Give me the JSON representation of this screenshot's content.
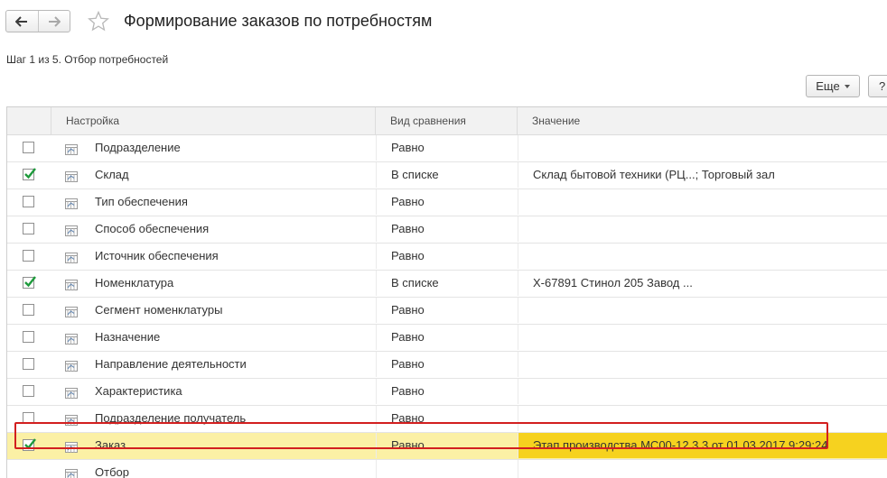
{
  "window": {
    "title": "Формирование заказов по потребностям",
    "step_text": "Шаг 1 из 5. Отбор потребностей"
  },
  "toolbar": {
    "back_icon": "arrow-left-icon",
    "forward_icon": "arrow-right-icon",
    "favorite_icon": "star-outline-icon",
    "more_label": "Еще",
    "help_label": "?"
  },
  "table": {
    "columns": [
      "Настройка",
      "Вид сравнения",
      "Значение"
    ],
    "rows": [
      {
        "checked": false,
        "name": "Подразделение",
        "comparison": "Равно",
        "value": ""
      },
      {
        "checked": true,
        "name": "Склад",
        "comparison": "В списке",
        "value": "Склад бытовой техники (РЦ...; Торговый зал"
      },
      {
        "checked": false,
        "name": "Тип обеспечения",
        "comparison": "Равно",
        "value": ""
      },
      {
        "checked": false,
        "name": "Способ обеспечения",
        "comparison": "Равно",
        "value": ""
      },
      {
        "checked": false,
        "name": "Источник обеспечения",
        "comparison": "Равно",
        "value": ""
      },
      {
        "checked": true,
        "name": "Номенклатура",
        "comparison": "В списке",
        "value": "Х-67891 Стинол 205 Завод ..."
      },
      {
        "checked": false,
        "name": "Сегмент номенклатуры",
        "comparison": "Равно",
        "value": ""
      },
      {
        "checked": false,
        "name": "Назначение",
        "comparison": "Равно",
        "value": ""
      },
      {
        "checked": false,
        "name": "Направление деятельности",
        "comparison": "Равно",
        "value": ""
      },
      {
        "checked": false,
        "name": "Характеристика",
        "comparison": "Равно",
        "value": ""
      },
      {
        "checked": false,
        "name": "Подразделение получатель",
        "comparison": "Равно",
        "value": ""
      },
      {
        "checked": true,
        "name": "Заказ",
        "comparison": "Равно",
        "value": "Этап производства МС00-12.3.3 от 01.03.2017 9:29:24",
        "selected": true
      },
      {
        "checked": null,
        "name": "Отбор",
        "comparison": "",
        "value": ""
      }
    ]
  },
  "colors": {
    "selected_row": "#fbf0a5",
    "selected_value_cell": "#f6d21f",
    "highlight_border": "#d21f1f",
    "checkmark": "#1e9a3c"
  }
}
